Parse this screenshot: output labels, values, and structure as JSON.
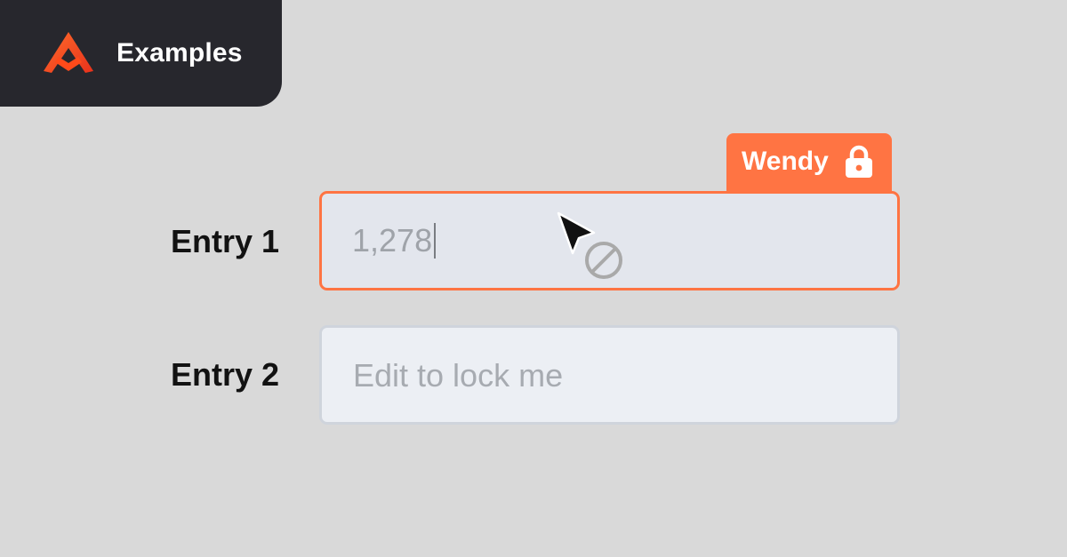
{
  "brand": {
    "label": "Examples",
    "logo_icon": "rhombus-arrow-logo",
    "tab_color": "#27272d",
    "accent": "#ff4a1a"
  },
  "rows": [
    {
      "label": "Entry 1",
      "value": "1,278",
      "state": "locked",
      "border_color": "#ff7443"
    },
    {
      "label": "Entry 2",
      "placeholder": "Edit to lock me",
      "state": "editable",
      "border_color": "#cfd4dc"
    }
  ],
  "lock_badge": {
    "user": "Wendy",
    "icon": "lock-icon",
    "color": "#ff7443"
  },
  "cursor": {
    "icon": "not-allowed-cursor-icon"
  }
}
